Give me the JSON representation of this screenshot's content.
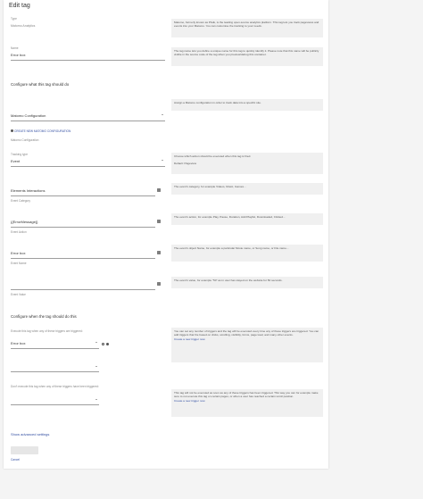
{
  "page": {
    "title": "Edit tag"
  },
  "type": {
    "label": "Type",
    "value": "Matomo Analytics"
  },
  "name": {
    "label": "Name",
    "value": "Error box"
  },
  "help": {
    "type": "Matomo, formerly known as Piwik, is the leading open-source analytics platform. This tag lets you track pageviews and events into your Matomo. You can customise the tracking to your needs.",
    "name": "The tag name lets you define a unique name for this tag to quickly identify it. Please note that this name will be publicly visible in the source code of the tag when you preview/debug this container.",
    "config": "Assign a Matomo configuration in order to track data into a specific site.",
    "tracking": "Choose which action should be executed when this tag is fired.",
    "tracking_default": "Default: Pageview",
    "category": "The event's category, for example Videos, Music, Games...",
    "action": "The event's action, for example Play, Pause, Duration, Add Playlist, Downloaded, Clicked...",
    "event_name": "The event's object Name, for example a particular Movie name, or Song name, or File name...",
    "event_value": "The event's value, for example \"50\" as in user has stayed on the website for 50 seconds.",
    "fire": "You can set any number of triggers and the tag will be executed every time any of these triggers are triggered. You can add triggers that fire based on clicks, scrolling, visibility, forms, page load, and many other events.",
    "fire_link": "Create a new trigger now",
    "block": "This tag will not be executed as soon as any of these triggers has been triggered. This way you can for example make sure to not execute this tag on certain pages, or when a user has reached a certain scroll position.",
    "block_link": "Create a new trigger now"
  },
  "section_tag": "Configure what this tag should do",
  "config": {
    "value": "Matomo Configuration",
    "create_link": "CREATE NEW MATOMO CONFIGURATION",
    "label": "Matomo Configuration"
  },
  "tracking": {
    "label": "Tracking type",
    "value": "Event"
  },
  "category": {
    "value": "Elements Interactions",
    "label": "Event Category"
  },
  "action": {
    "value": "{{ErrorMessage}}",
    "label": "Event Action"
  },
  "event_name": {
    "value": "Error box",
    "label": "Event Name"
  },
  "event_value": {
    "value": "",
    "label": "Event Value"
  },
  "section_trigger": "Configure when the tag should do this",
  "fire": {
    "label": "Execute this tag when any of these triggers are triggered:",
    "value": "Error box",
    "empty": ""
  },
  "block": {
    "label": "Don't execute this tag when any of these triggers have been triggered:",
    "value": ""
  },
  "advanced_link": "Show advanced settings",
  "buttons": {
    "update": "Update",
    "cancel": "Cancel"
  }
}
